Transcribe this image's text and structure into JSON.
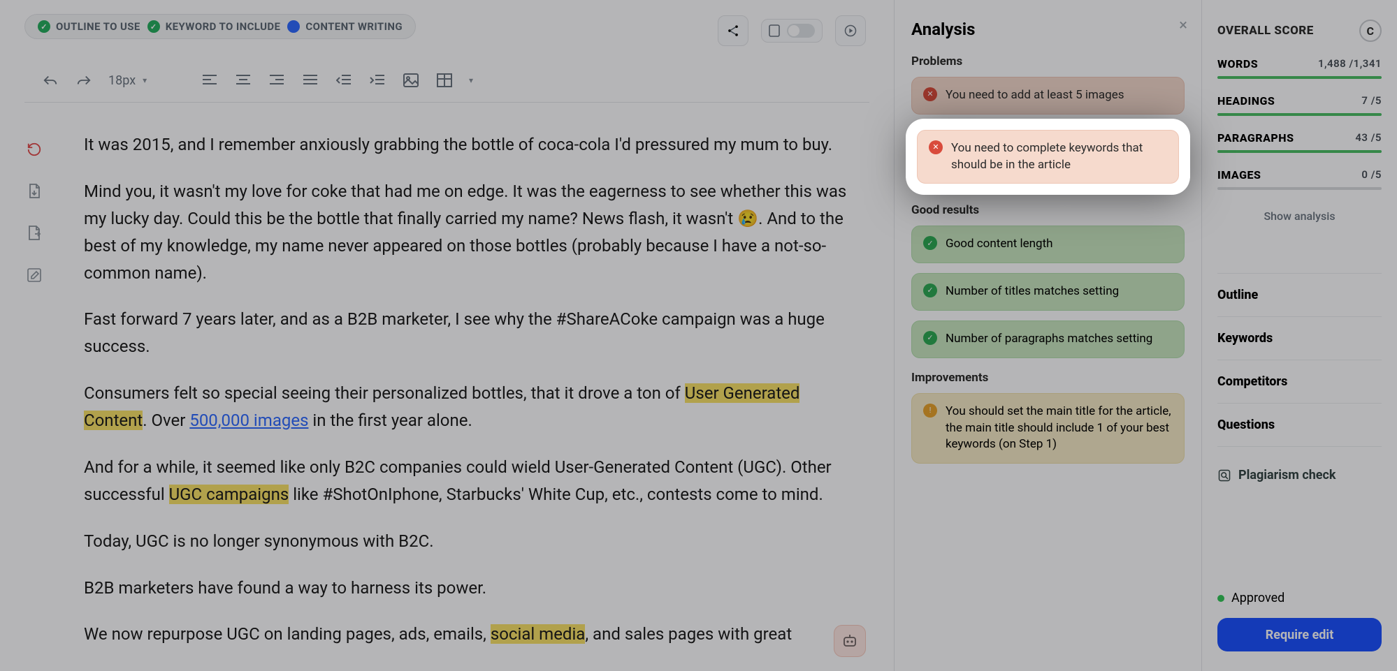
{
  "steps": {
    "outline": "OUTLINE TO USE",
    "keyword": "KEYWORD TO INCLUDE",
    "content": "CONTENT WRITING"
  },
  "toolbar": {
    "font_size": "18px"
  },
  "article": {
    "p1": "It was 2015, and I remember anxiously grabbing the bottle of coca-cola I'd pressured my mum to buy.",
    "p2": "Mind you, it wasn't my love for coke that had me on edge. It was the eagerness to see whether this was my lucky day. Could this be the bottle that finally carried my name? News flash, it wasn't 😢. And to the best of my knowledge, my name never appeared on those bottles (probably because I have a not-so-common name).",
    "p3": "Fast forward 7 years later, and as a B2B marketer, I see why the #ShareACoke campaign was a huge success.",
    "p4a": "Consumers felt so special seeing their personalized bottles, that it drove a ton of ",
    "p4_hl": "User Generated Content",
    "p4b": ". Over ",
    "p4_link": "500,000 images",
    "p4c": " in the first year alone.",
    "p5a": "And for a while, it seemed like only B2C companies could wield User-Generated Content (UGC). Other successful ",
    "p5_hl": "UGC campaigns",
    "p5b": " like #ShotOnIphone, Starbucks' White Cup, etc., contests come to mind.",
    "p6": "Today, UGC is no longer synonymous with B2C.",
    "p7": "B2B marketers have found a way to harness its power.",
    "p8a": "We now repurpose UGC on landing pages, ads, emails, ",
    "p8_hl": "social media",
    "p8b": ", and sales pages with great"
  },
  "analysis": {
    "title": "Analysis",
    "problems_label": "Problems",
    "problems": [
      "You need to add at least 5 images",
      "You need to complete keywords that should be in the article"
    ],
    "good_label": "Good results",
    "good": [
      "Good content length",
      "Number of titles matches setting",
      "Number of paragraphs matches setting"
    ],
    "improve_label": "Improvements",
    "improve": [
      "You should set the main title for the article, the main title should include 1 of your best keywords (on Step 1)"
    ]
  },
  "metrics": {
    "score_label": "OVERALL SCORE",
    "score_letter": "C",
    "words_label": "WORDS",
    "words_value": "1,488 /1,341",
    "headings_label": "HEADINGS",
    "headings_value": "7 /5",
    "paragraphs_label": "PARAGRAPHS",
    "paragraphs_value": "43 /5",
    "images_label": "IMAGES",
    "images_value": "0 /5",
    "show_analysis": "Show analysis",
    "nav": {
      "outline": "Outline",
      "keywords": "Keywords",
      "competitors": "Competitors",
      "questions": "Questions"
    },
    "plagiarism": "Plagiarism check",
    "approved": "Approved",
    "require_edit": "Require edit"
  }
}
